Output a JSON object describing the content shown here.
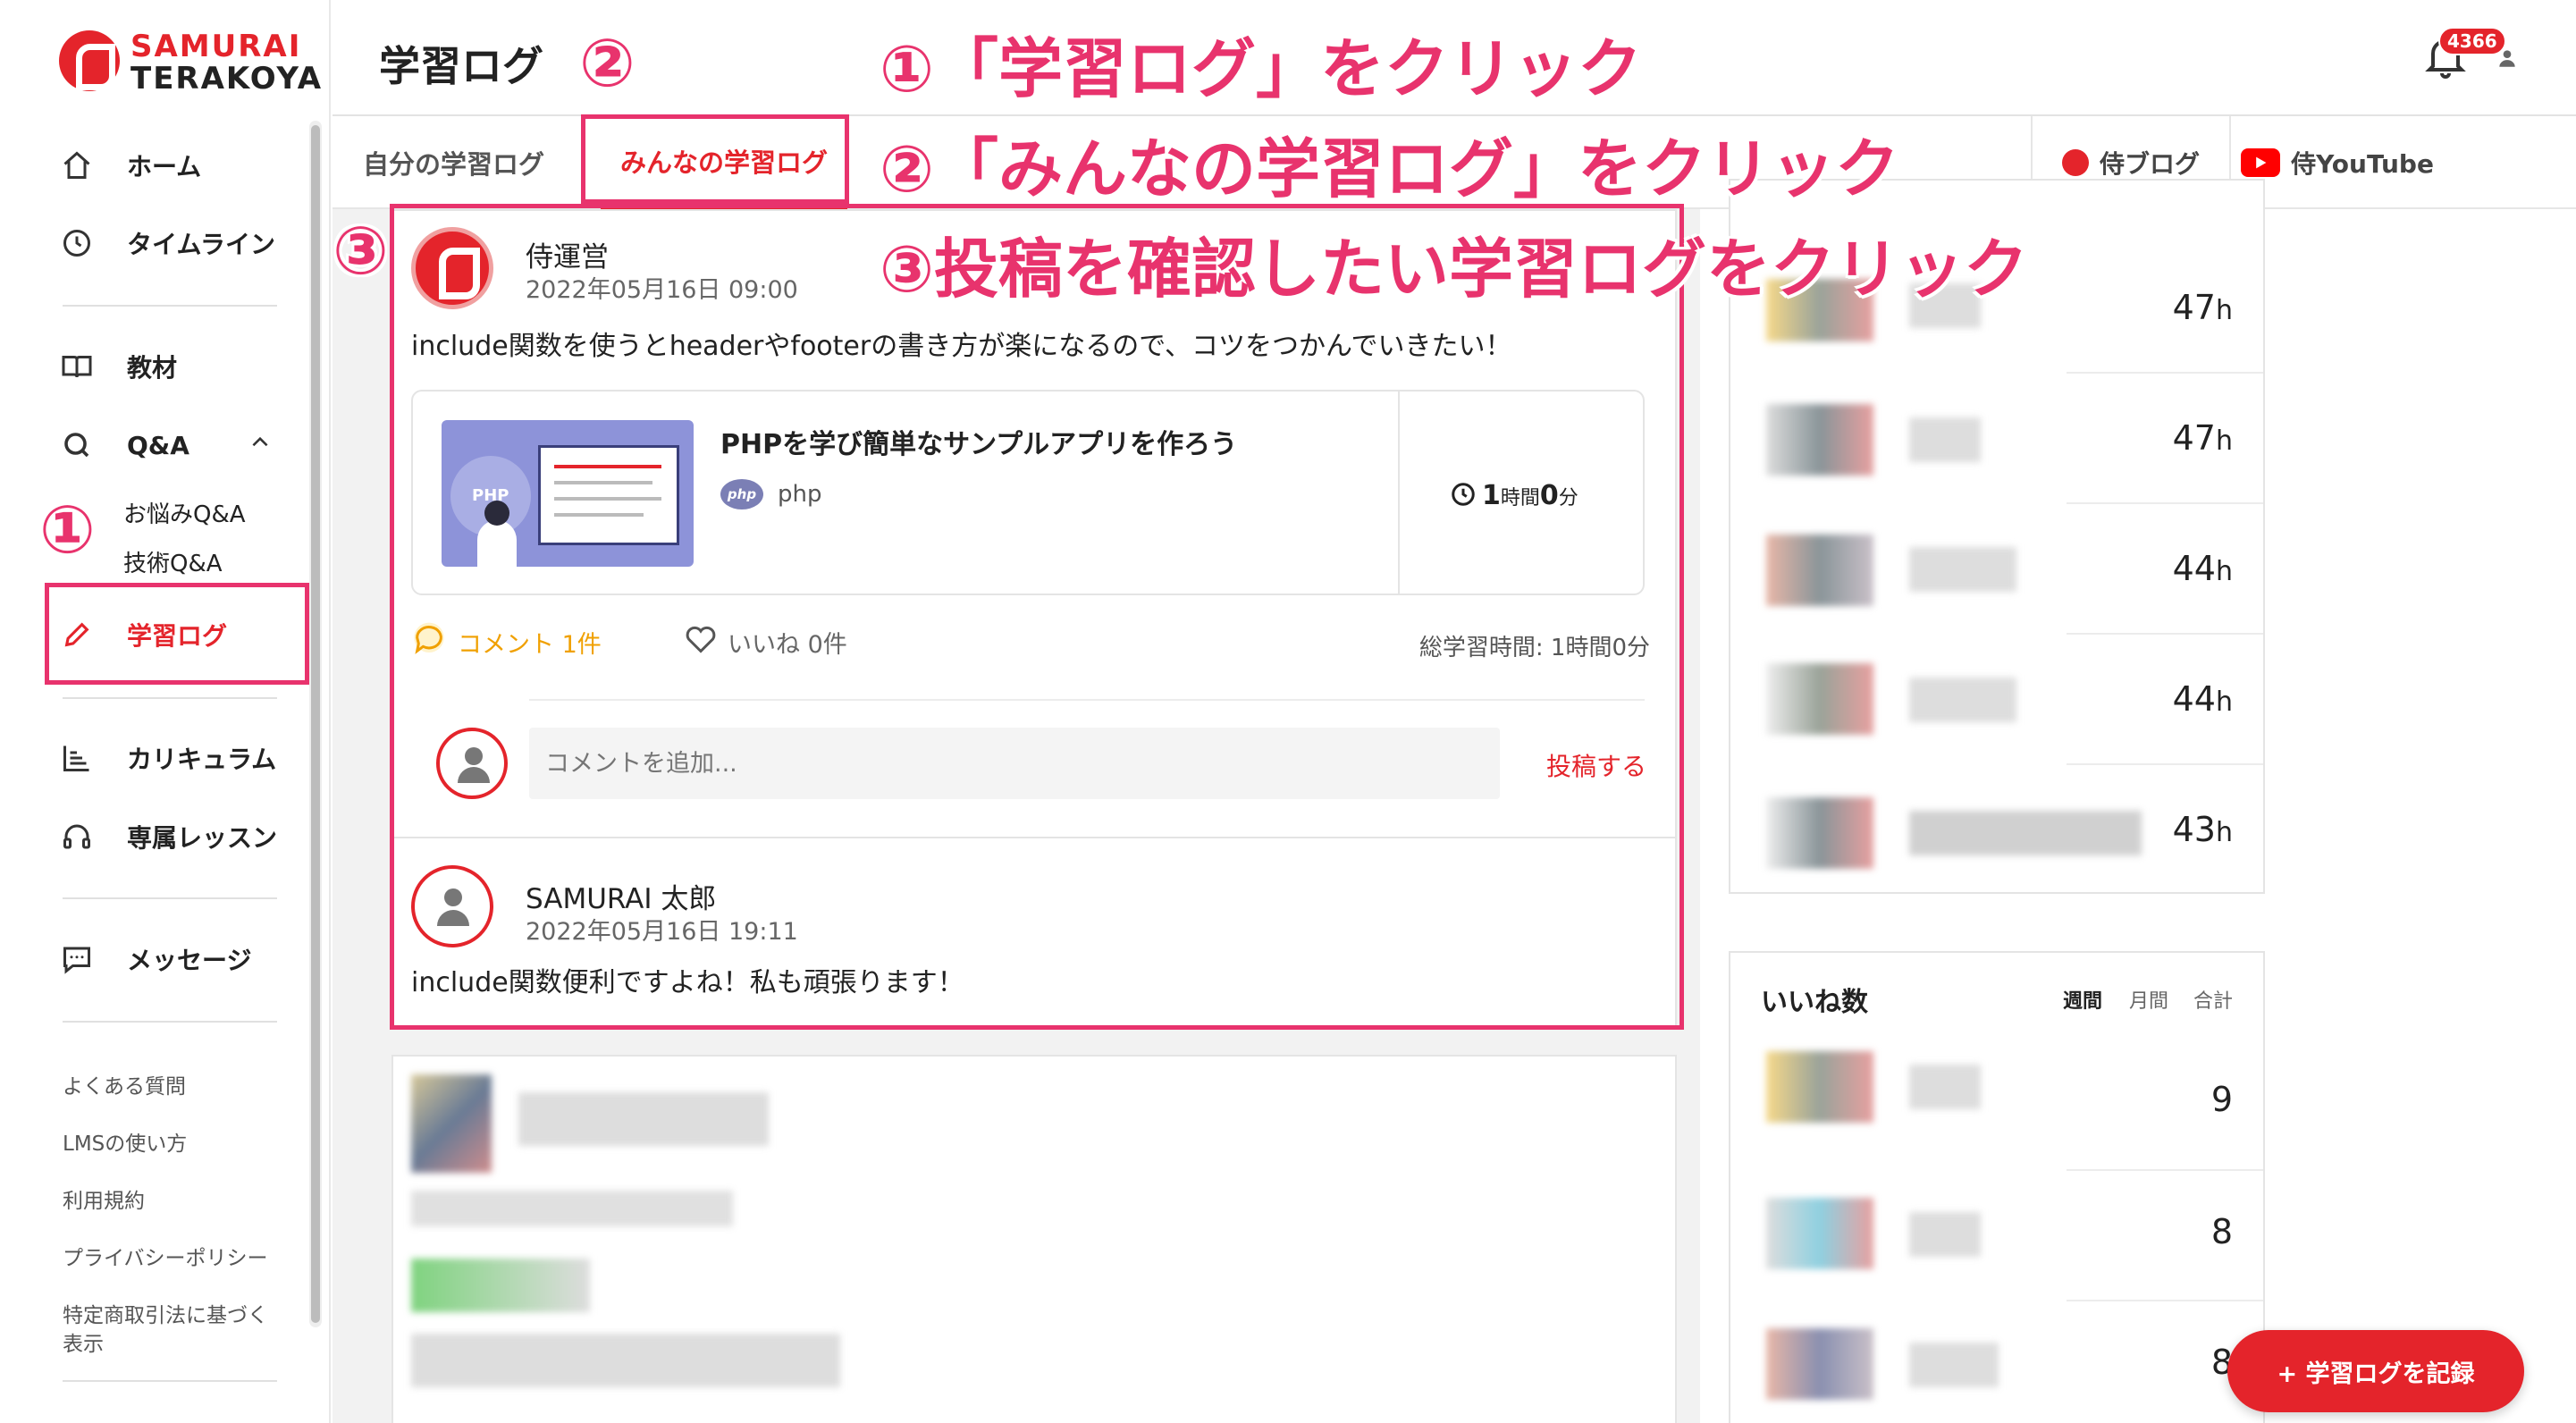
{
  "brand": {
    "line1": "SAMURAI",
    "line2": "TERAKOYA",
    "accent": "#e4242b",
    "annotation": "#e8336d"
  },
  "header": {
    "title": "学習ログ",
    "notification_count": "4366"
  },
  "sidebar": {
    "nav": [
      {
        "label": "ホーム",
        "icon": "home-icon"
      },
      {
        "label": "タイムライン",
        "icon": "clock-icon"
      },
      {
        "label": "教材",
        "icon": "book-icon"
      },
      {
        "label": "Q&A",
        "icon": "search-icon"
      },
      {
        "label": "学習ログ",
        "icon": "pencil-icon"
      },
      {
        "label": "カリキュラム",
        "icon": "chart-icon"
      },
      {
        "label": "専属レッスン",
        "icon": "headset-icon"
      },
      {
        "label": "メッセージ",
        "icon": "chat-icon"
      }
    ],
    "qa_sub": [
      "お悩みQ&A",
      "技術Q&A"
    ],
    "footer_links": [
      "よくある質問",
      "LMSの使い方",
      "利用規約",
      "プライバシーポリシー",
      "特定商取引法に基づく",
      "表示"
    ]
  },
  "tabs": {
    "mine": "自分の学習ログ",
    "everyone": "みんなの学習ログ"
  },
  "external": {
    "blog": "侍ブログ",
    "youtube": "侍YouTube"
  },
  "post": {
    "author": "侍運営",
    "date": "2022年05月16日 09:00",
    "text": "include関数を使うとheaderやfooterの書き方が楽になるので、コツをつかんでいきたい！",
    "material": {
      "title": "PHPを学び簡単なサンプルアプリを作ろう",
      "thumb_label": "PHP",
      "lang_badge": "php",
      "lang": "php",
      "time_hours": "1",
      "time_hours_unit": "時間",
      "time_minutes": "0",
      "time_minutes_unit": "分"
    },
    "comments_label": "コメント 1件",
    "likes_label": "いいね 0件",
    "total_time": "総学習時間: 1時間0分",
    "comment_placeholder": "コメントを追加...",
    "submit_label": "投稿する"
  },
  "reply": {
    "author": "SAMURAI 太郎",
    "date": "2022年05月16日 19:11",
    "text": "include関数便利ですよね！私も頑張ります！"
  },
  "ranking_hours": {
    "values": [
      "47",
      "47",
      "44",
      "44",
      "43"
    ],
    "unit": "h"
  },
  "ranking_likes": {
    "title": "いいね数",
    "filters": [
      "週間",
      "月間",
      "合計"
    ],
    "values": [
      "9",
      "8",
      "8"
    ]
  },
  "fab_label": "+ 学習ログを記録",
  "annotations": {
    "step1": "①「学習ログ」をクリック",
    "step2": "②「みんなの学習ログ」をクリック",
    "step3": "③投稿を確認したい学習ログをクリック",
    "num1": "①",
    "num2": "②",
    "num3": "③"
  }
}
